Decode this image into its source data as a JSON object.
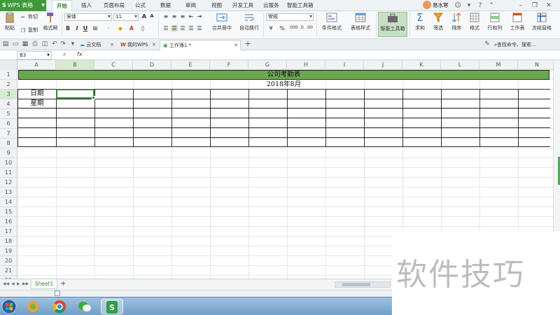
{
  "app": {
    "name": "WPS 表格",
    "logo": "S"
  },
  "menu": {
    "tabs": [
      "开始",
      "插入",
      "页面布局",
      "公式",
      "数据",
      "审阅",
      "视图",
      "开发工具",
      "云服务",
      "智能工具箱"
    ],
    "active_tab": "开始"
  },
  "user": {
    "name": "易水寒"
  },
  "ribbon": {
    "paste": "粘贴",
    "cut": "剪切",
    "copy": "复制",
    "format_painter": "格式刷",
    "font_name": "宋体",
    "font_size": "11",
    "bold": "B",
    "italic": "I",
    "underline": "U",
    "merge_center": "合并居中",
    "wrap_text": "自动换行",
    "number_format": "常规",
    "currency": "¥",
    "percent": "%",
    "cond_format": "条件格式",
    "table_style": "表格样式",
    "smart_toolbox": "智能工具箱",
    "sum": "求和",
    "filter": "筛选",
    "sort": "排序",
    "format": "格式",
    "row_col": "行和列",
    "worksheet": "工作表",
    "freeze": "冻结窗格"
  },
  "doc_tabs": {
    "cloud_docs": "云文档",
    "my_wps": "我的WPS",
    "active_doc": "工作簿1 *",
    "search": "查找命令、搜索..."
  },
  "formula_bar": {
    "cell_ref": "B3",
    "fx": "fx",
    "value": ""
  },
  "grid": {
    "columns": [
      "A",
      "B",
      "C",
      "D",
      "E",
      "F",
      "G",
      "H",
      "I",
      "J",
      "K",
      "L",
      "M",
      "N"
    ],
    "rows": [
      "1",
      "2",
      "3",
      "4",
      "5",
      "6",
      "7",
      "8",
      "9",
      "10",
      "11",
      "12",
      "13",
      "14",
      "15",
      "16",
      "17",
      "18",
      "19",
      "20",
      "21",
      "22"
    ],
    "active_col": "B",
    "active_row": "3",
    "title": "公司考勤表",
    "subtitle": "2018年8月",
    "label_date": "日期",
    "label_weekday": "星期"
  },
  "sheets": {
    "active": "Sheet1",
    "add": "+"
  },
  "colors": {
    "brand_green": "#3e9a3a",
    "title_fill": "#6aa84f"
  },
  "watermark": "软件技巧"
}
